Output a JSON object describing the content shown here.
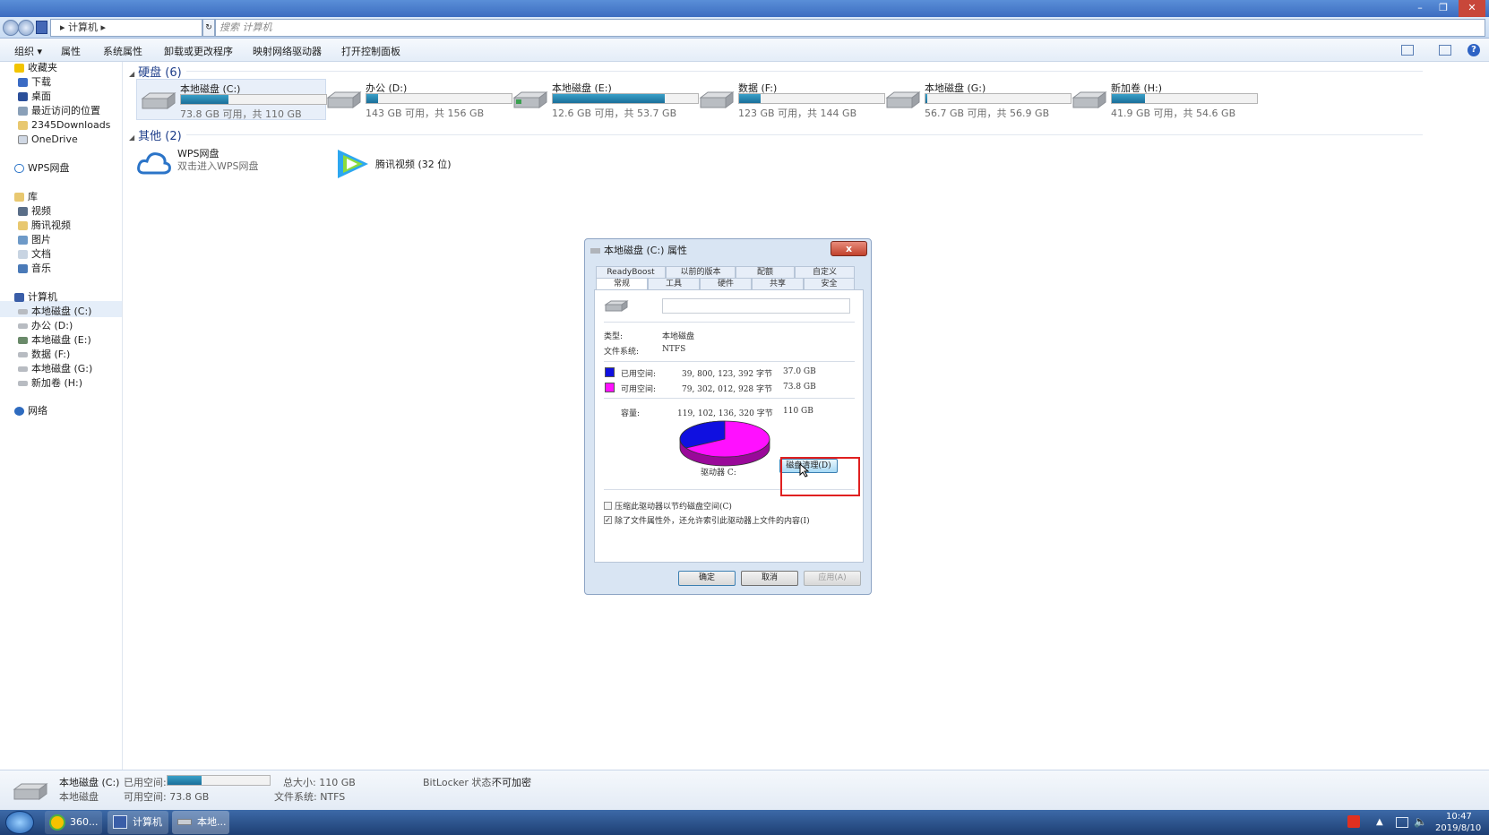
{
  "window": {
    "minimize": "–",
    "restore": "❐",
    "close": "✕"
  },
  "address": {
    "path": "▸ 计算机 ▸",
    "search_placeholder": "搜索 计算机",
    "refresh": "↻"
  },
  "toolbar": {
    "items": [
      "组织 ▾",
      "属性",
      "系统属性",
      "卸载或更改程序",
      "映射网络驱动器",
      "打开控制面板"
    ],
    "help": "?"
  },
  "sidebar": {
    "favorites": "收藏夹",
    "fav_items": [
      "下载",
      "桌面",
      "最近访问的位置",
      "2345Downloads",
      "OneDrive"
    ],
    "wps": "WPS网盘",
    "library": "库",
    "lib_items": [
      "视频",
      "腾讯视频",
      "图片",
      "文档",
      "音乐"
    ],
    "computer": "计算机",
    "drives": [
      "本地磁盘 (C:)",
      "办公 (D:)",
      "本地磁盘 (E:)",
      "数据 (F:)",
      "本地磁盘 (G:)",
      "新加卷 (H:)"
    ],
    "network": "网络"
  },
  "main": {
    "hard_disks_header": "硬盘 (6)",
    "drives": [
      {
        "name": "本地磁盘 (C:)",
        "info": "73.8 GB 可用，共 110 GB",
        "used_percent": 33
      },
      {
        "name": "办公 (D:)",
        "info": "143 GB 可用，共 156 GB",
        "used_percent": 8
      },
      {
        "name": "本地磁盘 (E:)",
        "info": "12.6 GB 可用，共 53.7 GB",
        "used_percent": 77
      },
      {
        "name": "数据 (F:)",
        "info": "123 GB 可用，共 144 GB",
        "used_percent": 15
      },
      {
        "name": "本地磁盘 (G:)",
        "info": "56.7 GB 可用，共 56.9 GB",
        "used_percent": 1
      },
      {
        "name": "新加卷 (H:)",
        "info": "41.9 GB 可用，共 54.6 GB",
        "used_percent": 23
      }
    ],
    "other_header": "其他 (2)",
    "wps_name": "WPS网盘",
    "wps_sub": "双击进入WPS网盘",
    "tencent": "腾讯视频 (32 位)"
  },
  "dialog": {
    "title": "本地磁盘 (C:) 属性",
    "close": "x",
    "tabs_top": [
      "ReadyBoost",
      "以前的版本",
      "配额",
      "自定义"
    ],
    "tabs_bottom": [
      "常规",
      "工具",
      "硬件",
      "共享",
      "安全"
    ],
    "type_label": "类型:",
    "type_value": "本地磁盘",
    "fs_label": "文件系统:",
    "fs_value": "NTFS",
    "used_label": "已用空间:",
    "used_bytes": "39, 800, 123, 392 字节",
    "used_gb": "37.0 GB",
    "free_label": "可用空间:",
    "free_bytes": "79, 302, 012, 928 字节",
    "free_gb": "73.8 GB",
    "cap_label": "容量:",
    "cap_bytes": "119, 102, 136, 320 字节",
    "cap_gb": "110 GB",
    "used_fraction": 0.334,
    "used_color": "#1010e0",
    "free_color": "#ff10ff",
    "drive_label": "驱动器 C:",
    "cleanup": "磁盘清理(D)",
    "compress": "压缩此驱动器以节约磁盘空间(C)",
    "index": "除了文件属性外，还允许索引此驱动器上文件的内容(I)",
    "ok": "确定",
    "cancel": "取消",
    "apply": "应用(A)"
  },
  "status": {
    "drive": "本地磁盘 (C:)",
    "type": "本地磁盘",
    "used_label": "已用空间:",
    "free": "可用空间: 73.8 GB",
    "total": "总大小: 110 GB",
    "fs": "文件系统: NTFS",
    "bitlocker_label": "BitLocker 状态:",
    "bitlocker_value": "不可加密",
    "used_percent": 33
  },
  "taskbar": {
    "items": [
      "360...",
      "计算机",
      "本地..."
    ],
    "time": "10:47",
    "date": "2019/8/10"
  }
}
